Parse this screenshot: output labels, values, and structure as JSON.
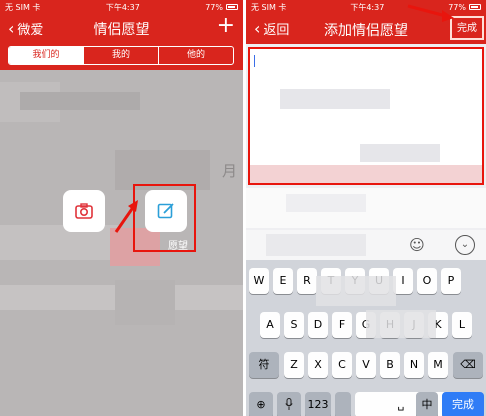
{
  "left": {
    "status": {
      "carrier": "无 SIM 卡",
      "time": "下午4:37",
      "battery": "77%"
    },
    "nav": {
      "back_label": "微爱",
      "title": "情侣愿望"
    },
    "tabs": [
      "我们的",
      "我的",
      "他的"
    ],
    "side_text": "月",
    "actions": {
      "write_label": "愿望"
    }
  },
  "right": {
    "status": {
      "carrier": "无 SIM 卡",
      "time": "下午4:37",
      "battery": "77%"
    },
    "nav": {
      "back_label": "返回",
      "title": "添加情侣愿望",
      "done_label": "完成"
    },
    "keyboard": {
      "row1": [
        "W",
        "E",
        "R",
        "T",
        "Y",
        "U",
        "I",
        "O",
        "P"
      ],
      "row2": [
        "A",
        "S",
        "D",
        "F",
        "G",
        "H",
        "J",
        "K",
        "L"
      ],
      "row3": [
        "Z",
        "X",
        "C",
        "V",
        "B",
        "N",
        "M"
      ],
      "symbol_key": "符",
      "num_key": "123",
      "cn_key": "中",
      "done_key": "完成"
    }
  },
  "colors": {
    "accent": "#d9251d",
    "highlight": "#e8150d",
    "keyboard_done": "#2f7cf6"
  }
}
